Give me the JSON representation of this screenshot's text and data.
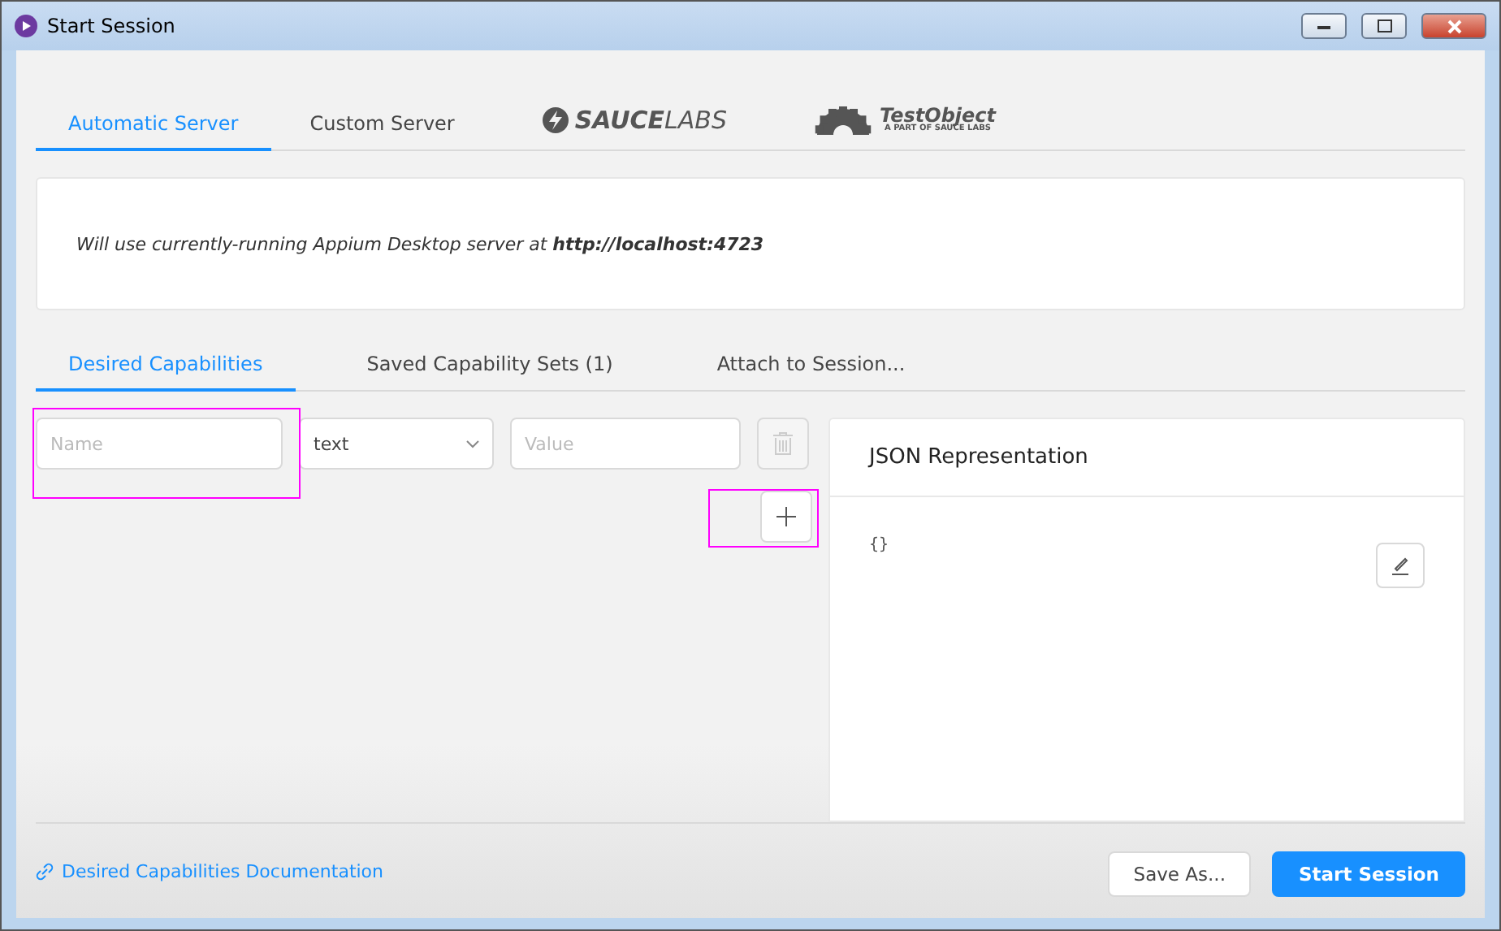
{
  "window": {
    "title": "Start Session"
  },
  "server_tabs": [
    {
      "kind": "text",
      "label": "Automatic Server",
      "selected": true
    },
    {
      "kind": "text",
      "label": "Custom Server",
      "selected": false
    },
    {
      "kind": "logo",
      "label": "SAUCE",
      "label_2": "LABS",
      "selected": false
    },
    {
      "kind": "gearlogo",
      "label": "TestObject",
      "label_2": "A PART OF SAUCE LABS",
      "selected": false
    }
  ],
  "server_info": {
    "text": "Will use currently-running Appium Desktop server at **http://localhost:4723**"
  },
  "capability_tabs": [
    {
      "label": "Desired Capabilities",
      "selected": true
    },
    {
      "label": "Saved Capability Sets (1)",
      "selected": false
    },
    {
      "label": "Attach to Session...",
      "selected": false
    }
  ],
  "capability_row": {
    "name": {
      "placeholder": "Name"
    },
    "type": {
      "value": "text"
    },
    "value": {
      "placeholder": "Value"
    }
  },
  "json_panel": {
    "title": "JSON Representation",
    "content": "{}"
  },
  "footer": {
    "link": "Desired Capabilities Documentation",
    "buttons": [
      {
        "label": "Save As...",
        "primary": false
      },
      {
        "label": "Start Session",
        "primary": true
      }
    ]
  }
}
